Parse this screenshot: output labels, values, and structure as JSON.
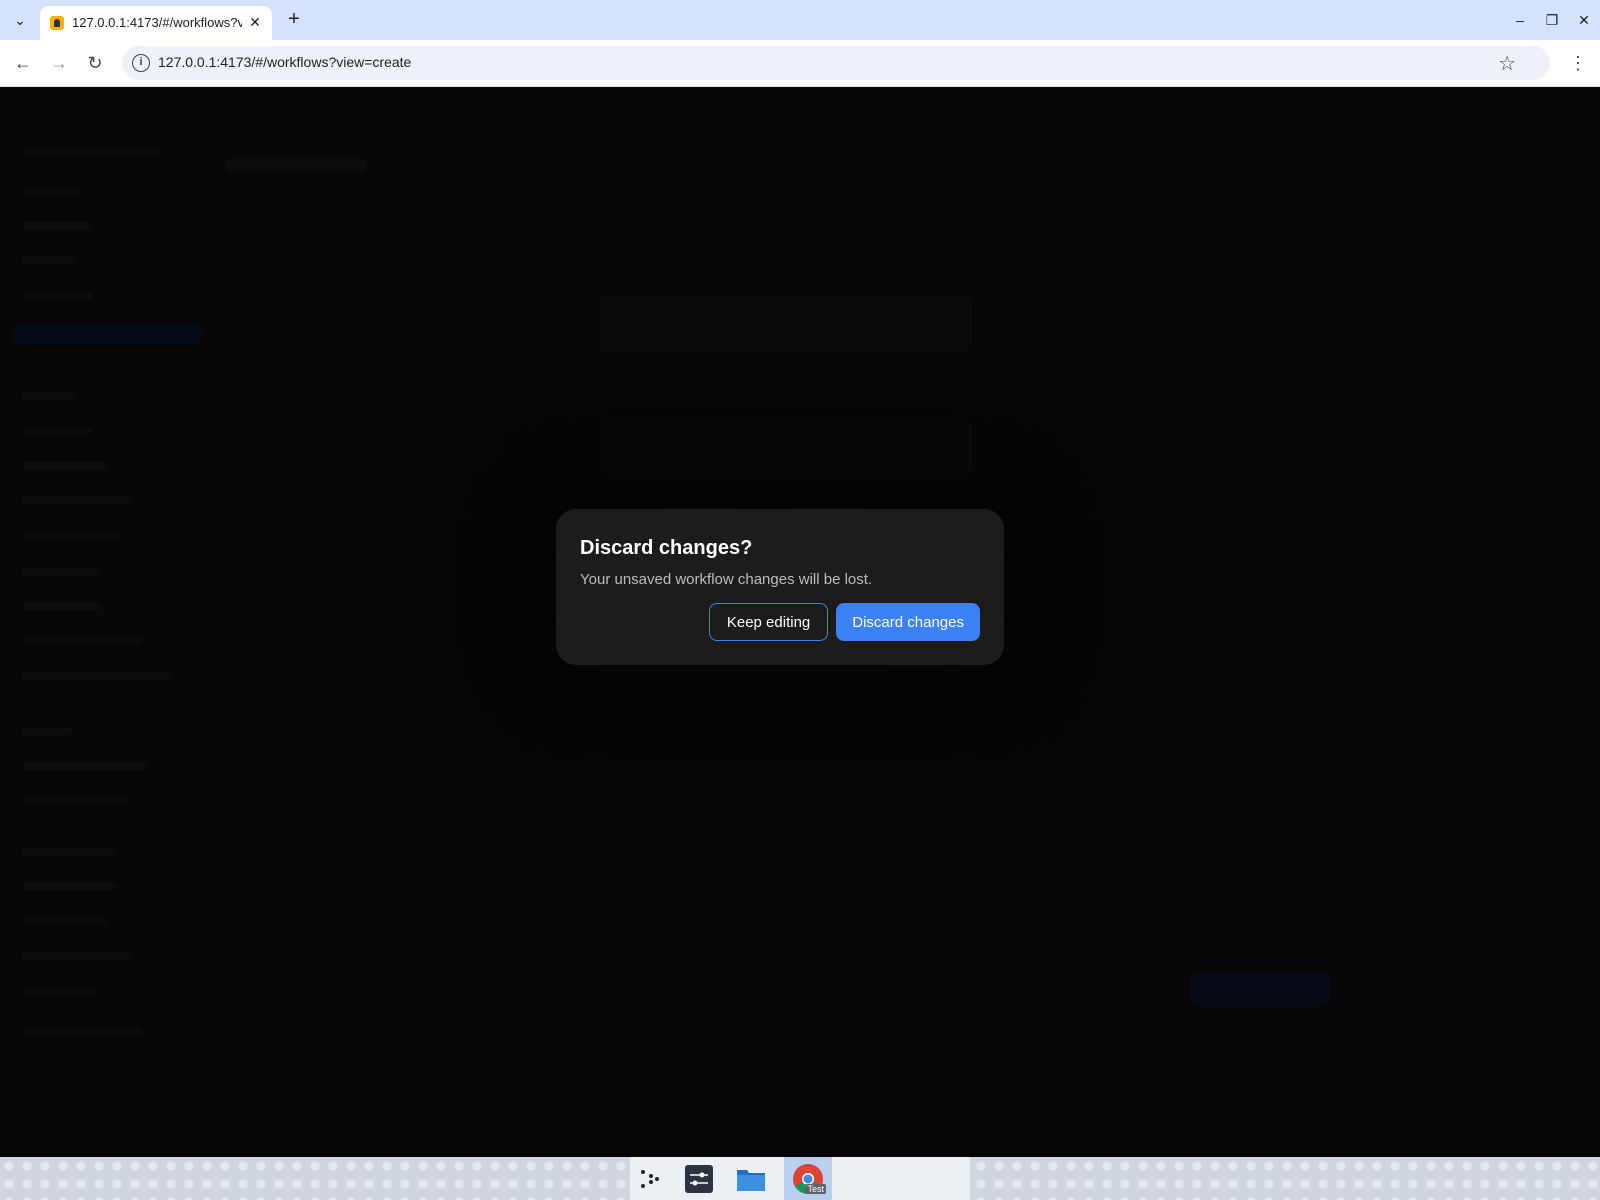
{
  "browser": {
    "tab_title": "127.0.0.1:4173/#/workflows?view=create",
    "url": "127.0.0.1:4173/#/workflows?view=create",
    "new_tab_glyph": "+",
    "tab_close_glyph": "✕",
    "star_glyph": "☆",
    "menu_glyph": "⋮",
    "back_glyph": "←",
    "forward_glyph": "→",
    "reload_glyph": "↻",
    "tab_menu_glyph": "⌄",
    "info_glyph": "i",
    "minimize_glyph": "–",
    "restore_glyph": "❐",
    "close_glyph": "✕"
  },
  "dialog": {
    "title": "Discard changes?",
    "message": "Your unsaved workflow changes will be lost.",
    "keep_label": "Keep editing",
    "discard_label": "Discard changes"
  },
  "taskbar": {
    "chrome_badge": "Test"
  },
  "colors": {
    "accent": "#3b82f6",
    "dialog_bg": "#1c1c1c",
    "tabstrip": "#d3e3fd"
  }
}
